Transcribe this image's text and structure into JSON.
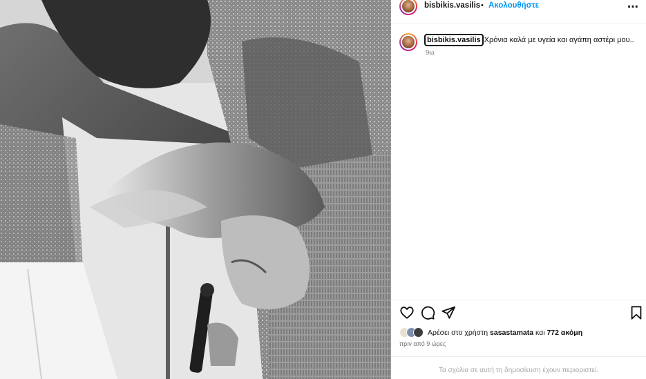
{
  "post": {
    "username": "bisbikis.vasilis",
    "separator": "•",
    "follow_label": "Ακολουθήστε",
    "more_icon": "⋯"
  },
  "caption": {
    "username": "bisbikis.vasilis",
    "text": "Χρόνια καλά με υγεία και αγάπη αστέρι μου..",
    "time": "9ω"
  },
  "actions": {
    "like_icon": "heart-icon",
    "comment_icon": "comment-icon",
    "share_icon": "share-icon",
    "save_icon": "bookmark-icon"
  },
  "likes": {
    "prefix": "Αρέσει στο χρήστη",
    "user": "sasastamata",
    "conjunction": "και",
    "count": "772 ακόμη",
    "posted": "πριν από 9 ώρες"
  },
  "comments": {
    "restricted_text": "Τα σχόλια σε αυτή τη δημοσίευση έχουν περιοριστεί."
  },
  "colors": {
    "accent": "#0095f6",
    "secondary_text": "#737373",
    "muted_text": "#a8a8a8"
  }
}
